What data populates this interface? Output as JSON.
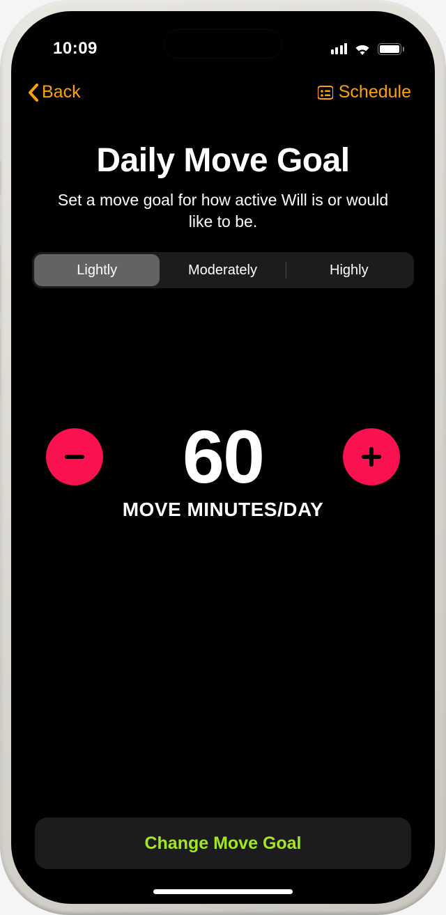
{
  "status": {
    "time": "10:09"
  },
  "nav": {
    "back_label": "Back",
    "schedule_label": "Schedule"
  },
  "header": {
    "title": "Daily Move Goal",
    "subtitle": "Set a move goal for how active Will is or would like to be."
  },
  "segments": {
    "lightly": "Lightly",
    "moderately": "Moderately",
    "highly": "Highly"
  },
  "goal": {
    "value": "60",
    "unit": "MOVE MINUTES/DAY"
  },
  "actions": {
    "change_goal": "Change Move Goal"
  },
  "colors": {
    "accent_orange": "#ff9f0a",
    "accent_pink": "#fa114f",
    "accent_green": "#a4e720"
  }
}
